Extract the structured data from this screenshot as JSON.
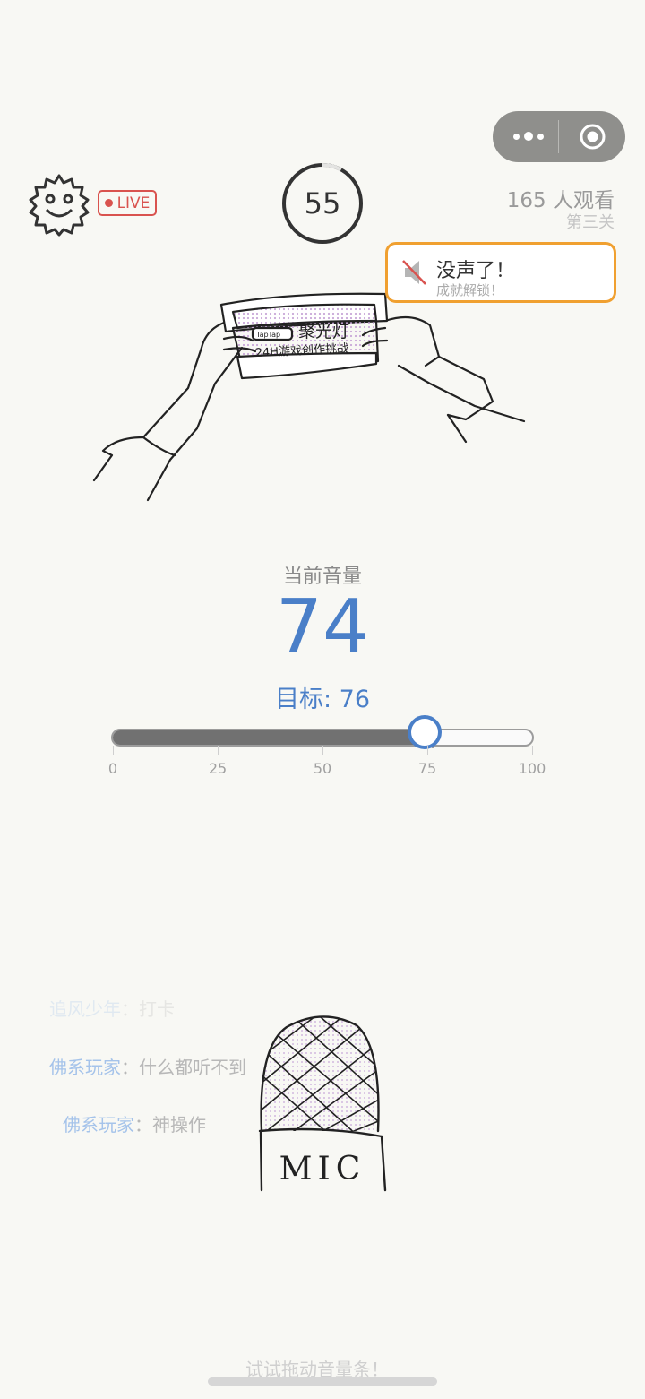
{
  "header": {
    "live_label": "LIVE",
    "timer": "55",
    "timer_progress": 0.08,
    "viewers": "165 人观看",
    "level": "第三关"
  },
  "capsule": {
    "menu_icon": "more-dots-icon",
    "close_icon": "target-close-icon"
  },
  "toast": {
    "icon": "mute-speaker-icon",
    "title": "没声了！",
    "subtitle": "成就解锁！"
  },
  "volume": {
    "label": "当前音量",
    "value": "74",
    "target_text": "目标: 76",
    "current": 74,
    "target": 76,
    "min": 0,
    "max": 100,
    "ticks": [
      "0",
      "25",
      "50",
      "75",
      "100"
    ]
  },
  "sketch": {
    "badge": "TapTap",
    "title": "聚光灯",
    "subtitle": "24H游戏创作挑战"
  },
  "chat": [
    {
      "user": "追风少年",
      "sep": "：",
      "msg": "打卡"
    },
    {
      "user": "佛系玩家",
      "sep": "：",
      "msg": "什么都听不到"
    },
    {
      "user": "佛系玩家",
      "sep": "：",
      "msg": "神操作"
    }
  ],
  "mic_label": "MIC",
  "hint": "试试拖动音量条！",
  "colors": {
    "accent": "#4a7fc8",
    "live": "#d9534f",
    "toast_border": "#f0a030"
  }
}
